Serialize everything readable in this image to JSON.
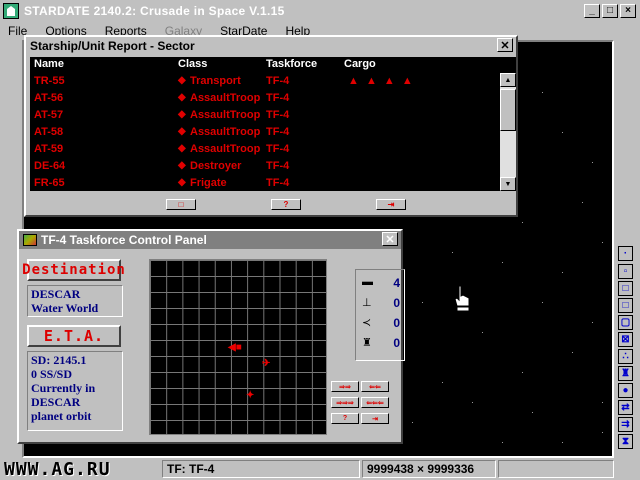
{
  "app": {
    "title": "STARDATE 2140.2: Crusade in Space V.1.15",
    "window_buttons": [
      "_",
      "□",
      "×"
    ]
  },
  "menu": [
    "File",
    "Options",
    "Reports",
    "Galaxy",
    "StarDate",
    "Help"
  ],
  "report_window": {
    "title": "Starship/Unit Report - Sector",
    "columns": [
      "Name",
      "Class",
      "Taskforce",
      "Cargo"
    ],
    "rows": [
      {
        "name": "TR-55",
        "class": "Transport",
        "taskforce": "TF-4",
        "cargo": "▲ ▲ ▲ ▲"
      },
      {
        "name": "AT-56",
        "class": "AssaultTroop",
        "taskforce": "TF-4",
        "cargo": ""
      },
      {
        "name": "AT-57",
        "class": "AssaultTroop",
        "taskforce": "TF-4",
        "cargo": ""
      },
      {
        "name": "AT-58",
        "class": "AssaultTroop",
        "taskforce": "TF-4",
        "cargo": ""
      },
      {
        "name": "AT-59",
        "class": "AssaultTroop",
        "taskforce": "TF-4",
        "cargo": ""
      },
      {
        "name": "DE-64",
        "class": "Destroyer",
        "taskforce": "TF-4",
        "cargo": ""
      },
      {
        "name": "FR-65",
        "class": "Frigate",
        "taskforce": "TF-4",
        "cargo": ""
      }
    ],
    "buttons": [
      "□",
      "?",
      "⇥"
    ]
  },
  "taskforce_panel": {
    "title": "TF-4 Taskforce Control Panel",
    "destination_label": "Destination",
    "destination_lines": [
      "DESCAR",
      "Water World"
    ],
    "eta_label": "E.T.A.",
    "eta_lines": [
      "SD: 2145.1",
      "0 SS/SD",
      "Currently in",
      "DESCAR",
      "planet orbit"
    ],
    "counts": [
      {
        "icon": "transport-icon",
        "value": "4"
      },
      {
        "icon": "troop-icon",
        "value": "0"
      },
      {
        "icon": "fighter-icon",
        "value": "0"
      },
      {
        "icon": "tank-icon",
        "value": "0"
      }
    ],
    "control_buttons": [
      "⇒⇒",
      "⇐⇐",
      "⇒⇒⇒",
      "⇐⇐⇐",
      "?",
      "⇥"
    ]
  },
  "status": {
    "watermark": "WWW.AG.RU",
    "taskforce": "TF: TF-4",
    "coords": "9999438 × 9999336"
  },
  "colors": {
    "accent_red": "#e00000",
    "info_blue": "#000080",
    "chrome": "#c0c0c0"
  }
}
